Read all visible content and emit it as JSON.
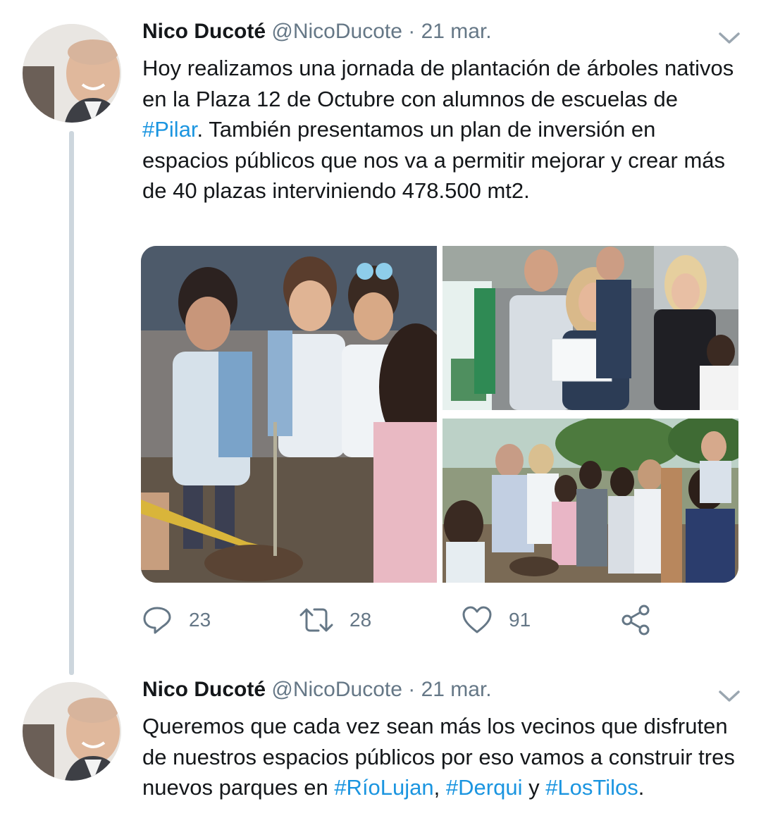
{
  "tweets": [
    {
      "author": "Nico Ducoté",
      "handle": "@NicoDucote",
      "separator": "·",
      "date": "21 mar.",
      "text": {
        "part1": "Hoy realizamos una jornada de plantación de árboles nativos en la Plaza 12 de Octubre con alumnos de escuelas de ",
        "hashtag1": "#Pilar",
        "part2": ".  También presentamos un plan de inversión en espacios públicos que nos va a permitir mejorar y crear más de 40 plazas interviniendo 478.500 mt2."
      },
      "media_count": 3,
      "actions": {
        "reply": {
          "icon": "reply-icon",
          "count": "23"
        },
        "retweet": {
          "icon": "retweet-icon",
          "count": "28"
        },
        "like": {
          "icon": "heart-icon",
          "count": "91"
        },
        "share": {
          "icon": "share-icon"
        }
      }
    },
    {
      "author": "Nico Ducoté",
      "handle": "@NicoDucote",
      "separator": "·",
      "date": "21 mar.",
      "text": {
        "part1": "Queremos que cada vez sean más los vecinos que disfruten de nuestros espacios públicos por eso vamos a construir tres nuevos parques en ",
        "hashtag1": "#RíoLujan",
        "sep1": ", ",
        "hashtag2": "#Derqui",
        "sep2": " y ",
        "hashtag3": "#LosTilos",
        "end": "."
      }
    }
  ],
  "colors": {
    "text": "#14171a",
    "secondary": "#657786",
    "link": "#1b95e0",
    "thread_line": "#cdd6dd"
  }
}
